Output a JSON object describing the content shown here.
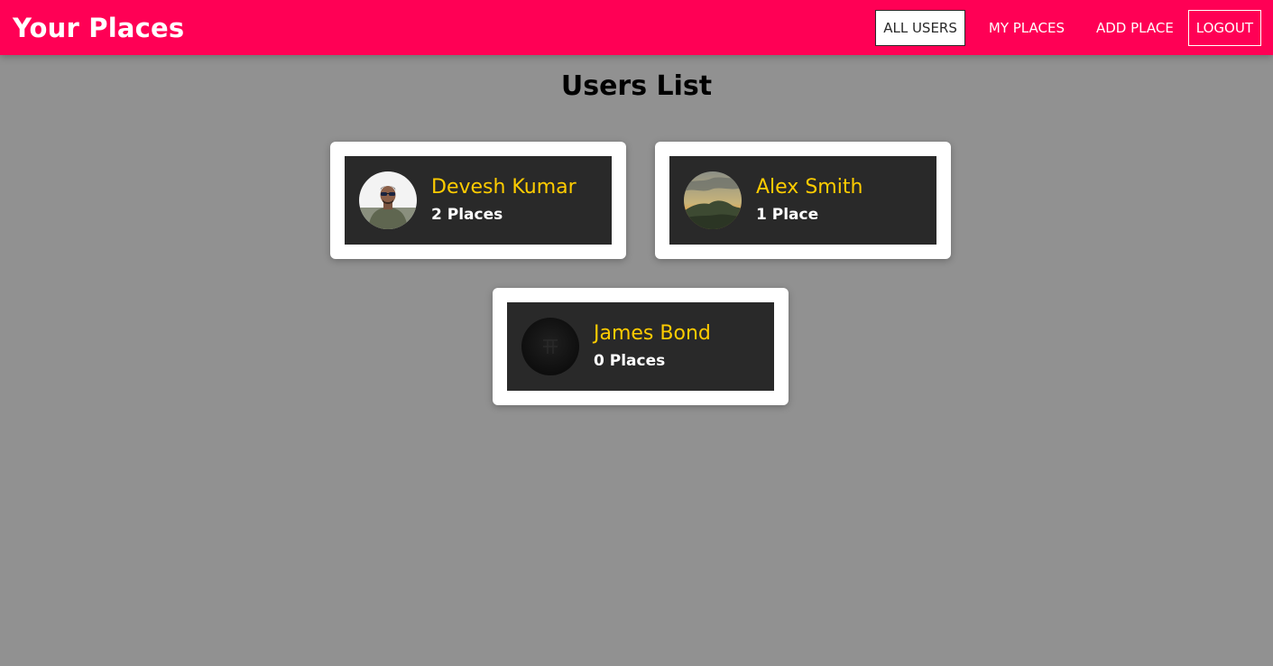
{
  "header": {
    "title": "Your Places",
    "nav": {
      "all_users": "ALL USERS",
      "my_places": "MY PLACES",
      "add_place": "ADD PLACE",
      "logout": "LOGOUT"
    }
  },
  "main": {
    "title": "Users List",
    "users": [
      {
        "name": "Devesh Kumar",
        "places": "2 Places",
        "avatar_icon": "person-photo"
      },
      {
        "name": "Alex Smith",
        "places": "1 Place",
        "avatar_icon": "landscape-photo"
      },
      {
        "name": "James Bond",
        "places": "0 Places",
        "avatar_icon": "dark-emblem"
      }
    ]
  },
  "colors": {
    "header_bg": "#ff0055",
    "page_bg": "#919191",
    "card_bg": "#ffffff",
    "card_inner_bg": "#292929",
    "name_color": "#ffcc00",
    "places_color": "#ffffff"
  }
}
